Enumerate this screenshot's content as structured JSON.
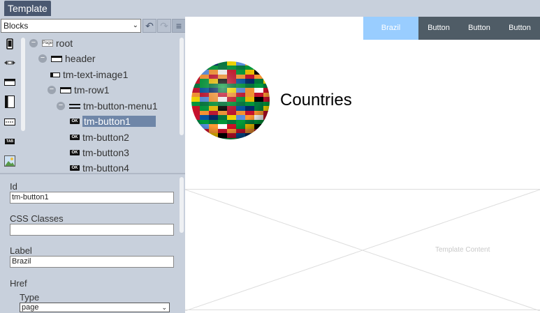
{
  "app": {
    "tab_label": "Template"
  },
  "toolbar": {
    "blocks_select": "Blocks",
    "caret": "⌄",
    "undo_glyph": "↶",
    "redo_glyph": "↷",
    "menu_glyph": "≡"
  },
  "palette": {
    "items": [
      "mobile-icon",
      "resize-horizontal-icon",
      "header-block-icon",
      "column-block-icon",
      "menu-block-icon",
      "tab-block-icon",
      "image-block-icon"
    ],
    "tab_text": "TAB"
  },
  "tree": {
    "toggle_glyph": "−",
    "page_icon_text": "Page",
    "ok_icon_text": "OK",
    "nodes": [
      {
        "label": "root",
        "icon": "page-icon",
        "has_toggle": true
      },
      {
        "label": "header",
        "icon": "header-icon",
        "has_toggle": true
      },
      {
        "label": "tm-text-image1",
        "icon": "text-image-icon",
        "has_toggle": false
      },
      {
        "label": "tm-row1",
        "icon": "header-icon",
        "has_toggle": true
      },
      {
        "label": "tm-button-menu1",
        "icon": "menu-icon",
        "has_toggle": true
      },
      {
        "label": "tm-button1",
        "icon": "ok-icon",
        "has_toggle": false,
        "selected": true
      },
      {
        "label": "tm-button2",
        "icon": "ok-icon",
        "has_toggle": false
      },
      {
        "label": "tm-button3",
        "icon": "ok-icon",
        "has_toggle": false
      },
      {
        "label": "tm-button4",
        "icon": "ok-icon",
        "has_toggle": false
      }
    ]
  },
  "properties": {
    "id_label": "Id",
    "id_value": "tm-button1",
    "css_label": "CSS Classes",
    "css_value": "",
    "label_label": "Label",
    "label_value": "Brazil",
    "href_label": "Href",
    "type_label": "Type",
    "type_value": "page"
  },
  "preview": {
    "nav_buttons": [
      {
        "label": "Brazil",
        "active": true
      },
      {
        "label": "Button"
      },
      {
        "label": "Button"
      },
      {
        "label": "Button"
      }
    ],
    "title": "Countries",
    "content_placeholder": "Template Content"
  },
  "colors": {
    "header_tab": "#4a5870",
    "nav_active": "#99cdff",
    "nav_button": "#4f5c66",
    "selection": "#6f86a8"
  }
}
